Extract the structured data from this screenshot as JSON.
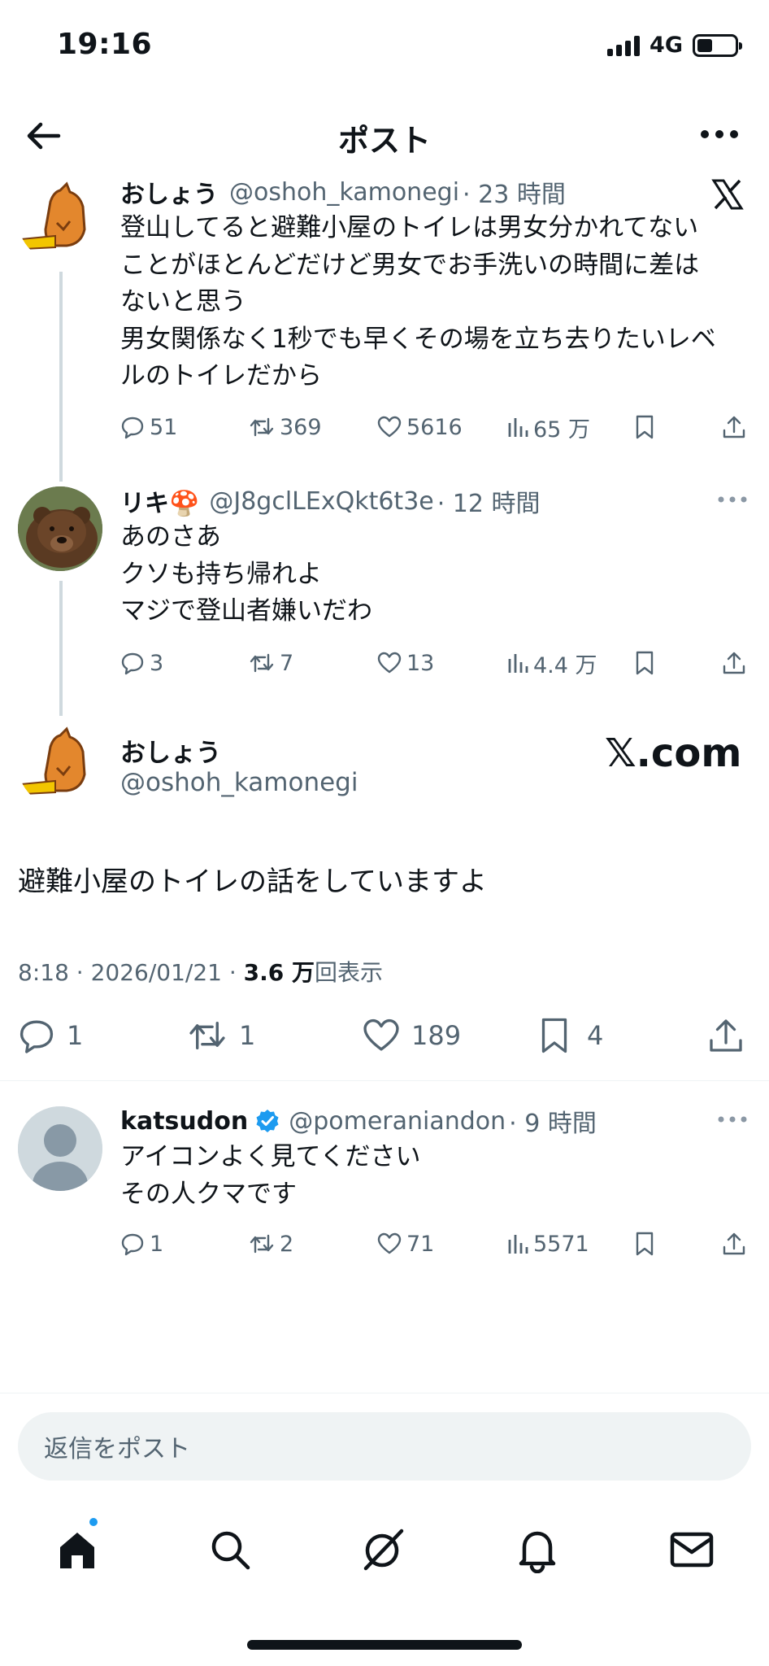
{
  "status": {
    "time": "19:16",
    "network": "4G"
  },
  "header": {
    "title": "ポスト"
  },
  "tweet1": {
    "name": "おしょう",
    "handle": "@oshoh_kamonegi",
    "time": "· 23 時間",
    "text": "登山してると避難小屋のトイレは男女分かれてない\nことがほとんどだけど男女でお手洗いの時間に差は\nないと思う\n男女関係なく1秒でも早くその場を立ち去りたいレベ\nルのトイレだから",
    "replies": "51",
    "reposts": "369",
    "likes": "5616",
    "views": "65 万"
  },
  "tweet2": {
    "name": "リキ🍄",
    "handle": "@J8gclLExQkt6t3e",
    "time": "· 12 時間",
    "text": "あのさあ\nクソも持ち帰れよ\nマジで登山者嫌いだわ",
    "replies": "3",
    "reposts": "7",
    "likes": "13",
    "views": "4.4 万"
  },
  "main": {
    "name": "おしょう",
    "handle": "@oshoh_kamonegi",
    "watermark": "𝕏.com",
    "text": "避難小屋のトイレの話をしていますよ",
    "timestamp": "8:18 · 2026/01/21 · ",
    "views_num": "3.6 万",
    "views_label": "回表示",
    "replies": "1",
    "reposts": "1",
    "likes": "189",
    "bookmarks": "4"
  },
  "tweet3": {
    "name": "katsudon",
    "handle": "@pomeraniandon",
    "time": "· 9 時間",
    "text": "アイコンよく見てください\nその人クマです",
    "replies": "1",
    "reposts": "2",
    "likes": "71",
    "views": "5571"
  },
  "reply_box": {
    "placeholder": "返信をポスト"
  },
  "colors": {
    "accent": "#1d9bf0",
    "text": "#0f1419",
    "secondary": "#536471",
    "line": "#cfd9de"
  },
  "icons": [
    "back-arrow-icon",
    "more-icon",
    "x-logo-icon",
    "reply-icon",
    "repost-icon",
    "like-icon",
    "views-icon",
    "bookmark-icon",
    "share-icon",
    "verified-icon",
    "home-icon",
    "search-icon",
    "grok-icon",
    "bell-icon",
    "mail-icon"
  ]
}
